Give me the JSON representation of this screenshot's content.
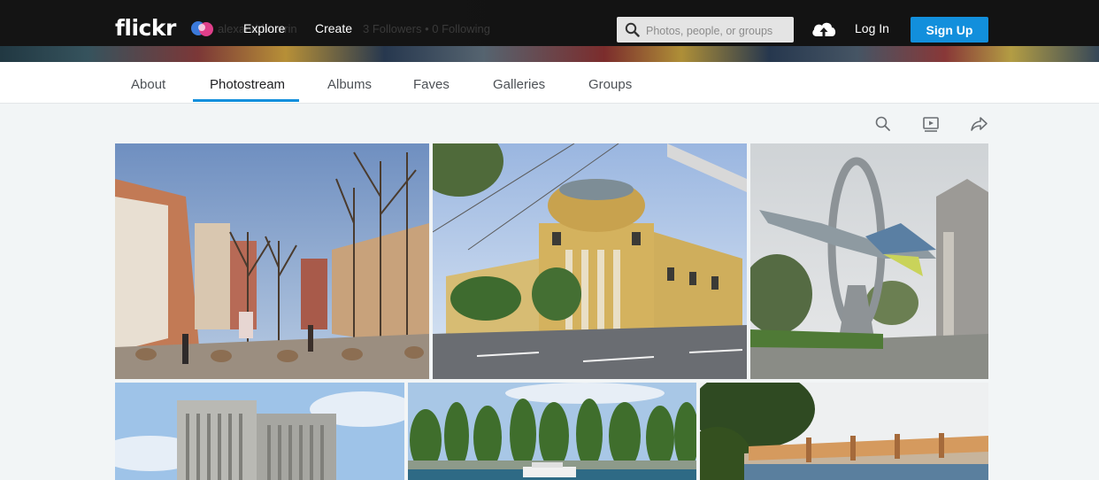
{
  "header": {
    "logo": "flickr",
    "profile_name": "alexandrbaturin",
    "profile_followers": "3 Followers • 0 Following",
    "nav": {
      "explore": "Explore",
      "create": "Create"
    },
    "search": {
      "placeholder": "Photos, people, or groups",
      "icon": "search-icon"
    },
    "upload_icon": "cloud-upload-icon",
    "login": "Log In",
    "signup": "Sign Up",
    "accent": "#128fdc"
  },
  "subnav": {
    "tabs": [
      {
        "label": "About",
        "active": false
      },
      {
        "label": "Photostream",
        "active": true
      },
      {
        "label": "Albums",
        "active": false
      },
      {
        "label": "Faves",
        "active": false
      },
      {
        "label": "Galleries",
        "active": false
      },
      {
        "label": "Groups",
        "active": false
      }
    ]
  },
  "toolbar": {
    "icons": [
      "search-icon",
      "slideshow-icon",
      "share-icon"
    ]
  },
  "photos": [
    {
      "subject": "tree-lined city street with pedestrians"
    },
    {
      "subject": "yellow domed neoclassical building"
    },
    {
      "subject": "jet aircraft monument with ring"
    },
    {
      "subject": "tall grey office tower"
    },
    {
      "subject": "riverside trees with boat"
    },
    {
      "subject": "circular stadium roof behind tree"
    }
  ]
}
